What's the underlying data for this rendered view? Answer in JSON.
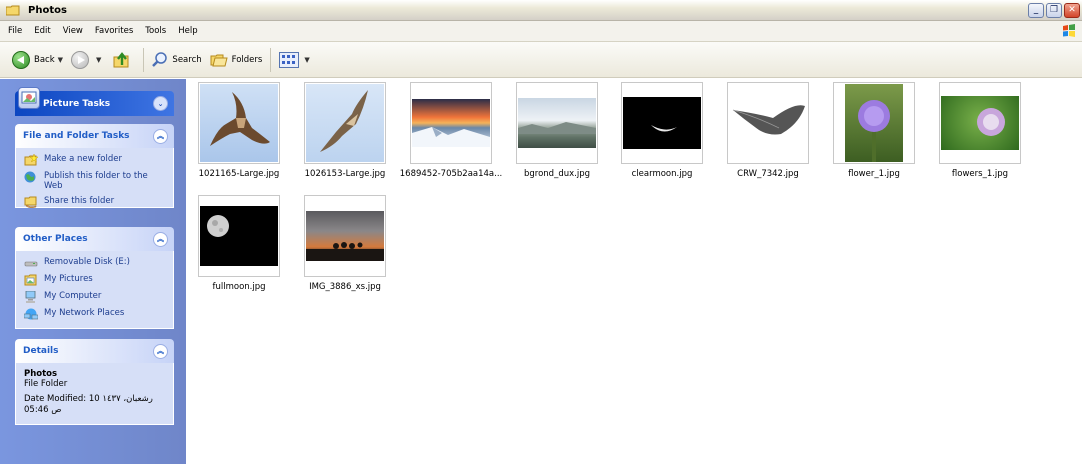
{
  "window": {
    "title": "Photos",
    "controls": [
      "minimize",
      "restore",
      "close"
    ]
  },
  "menu": {
    "items": [
      "File",
      "Edit",
      "View",
      "Favorites",
      "Tools",
      "Help"
    ]
  },
  "toolbar": {
    "back_label": "Back",
    "search_label": "Search",
    "folders_label": "Folders"
  },
  "left_pane": {
    "picture_tasks": {
      "title": "Picture Tasks"
    },
    "file_folder_tasks": {
      "title": "File and Folder Tasks",
      "items": [
        "Make a new folder",
        "Publish this folder to the Web",
        "Share this folder"
      ]
    },
    "other_places": {
      "title": "Other Places",
      "items": [
        "Removable Disk (E:)",
        "My Pictures",
        "My Computer",
        "My Network Places"
      ]
    },
    "details": {
      "title": "Details",
      "name": "Photos",
      "type": "File Folder",
      "modified_line1": "Date Modified: 10 رشعبان، ١٤٣٧",
      "modified_line2": "05:46 ص"
    }
  },
  "files": [
    {
      "name": "1021165-Large.jpg",
      "icon": "hawk-thumbnail"
    },
    {
      "name": "1026153-Large.jpg",
      "icon": "falcon-thumbnail"
    },
    {
      "name": "1689452-705b2aa14a...",
      "icon": "sunset-snow-thumbnail"
    },
    {
      "name": "bgrond_dux.jpg",
      "icon": "landscape-thumbnail"
    },
    {
      "name": "clearmoon.jpg",
      "icon": "crescent-moon-thumbnail"
    },
    {
      "name": "CRW_7342.jpg",
      "icon": "feather-thumbnail"
    },
    {
      "name": "flower_1.jpg",
      "icon": "purple-flower-thumbnail"
    },
    {
      "name": "flowers_1.jpg",
      "icon": "flower-bud-thumbnail"
    },
    {
      "name": "fullmoon.jpg",
      "icon": "full-moon-thumbnail"
    },
    {
      "name": "IMG_3886_xs.jpg",
      "icon": "sunset-trees-thumbnail"
    }
  ],
  "colors": {
    "sidebar": "#7a96df",
    "panel_body": "#d6dff7",
    "link_text": "#1c3c8e",
    "heading_text": "#215dc6"
  }
}
